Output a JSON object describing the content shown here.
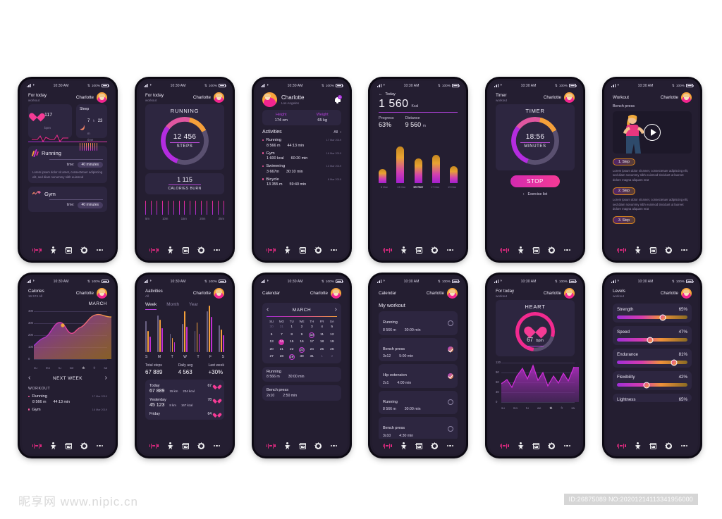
{
  "status_bar": {
    "time": "10:30 AM",
    "battery": "100%"
  },
  "nav": {
    "items": [
      "workout-icon",
      "profile-icon",
      "calendar-icon",
      "settings-icon",
      "more-icon"
    ]
  },
  "user": {
    "name": "Charlotte",
    "location": "Los Angeles"
  },
  "screens": {
    "today": {
      "header_title": "For today",
      "header_sub": "workout",
      "heart": {
        "value": "117",
        "unit": "bpm"
      },
      "sleep": {
        "title": "Sleep",
        "hours": "7",
        "h_unit": "h",
        "minutes": "23",
        "m_unit": "m",
        "label": "time"
      },
      "running": {
        "title": "Running",
        "time_label": "time:",
        "time_value": "40 minutes",
        "description": "Lorem ipsum dolor sit amet, consectetuer adipiscing elit, sed diam nonummy nibh euismod"
      },
      "gym": {
        "title": "Gym",
        "time_label": "time:",
        "time_value": "40 minutes"
      }
    },
    "running": {
      "header_title": "For today",
      "header_sub": "workout",
      "card_title": "RUNNING",
      "steps_value": "12 456",
      "steps_label": "STEPS",
      "calories_value": "1 115",
      "calories_label": "CALORIES BURN",
      "axis": [
        "5m",
        "10m",
        "15m",
        "20m",
        "25m"
      ]
    },
    "profile": {
      "height_label": "Height",
      "height_value": "174 cm",
      "weight_label": "Weight",
      "weight_value": "65 kg",
      "activities_title": "Activities",
      "all_label": "All",
      "notification_count": "1",
      "activities": [
        {
          "name": "Running",
          "date": "17 Mar 2019",
          "v1": "8 566 m",
          "v2": "44:13 min"
        },
        {
          "name": "Gym",
          "date": "16 Mar 2019",
          "v1": "1 600 kcal",
          "v2": "60:20 min"
        },
        {
          "name": "Swimming",
          "date": "13 Mar 2019",
          "v1": "3 667m",
          "v2": "30:10 min"
        },
        {
          "name": "Bicycle",
          "date": "8 Mar 2019",
          "v1": "13 355 m",
          "v2": "59:40 min"
        }
      ]
    },
    "kcal": {
      "back_label": "Today",
      "value": "1 560",
      "unit": "Kcal",
      "progress_label": "Progress",
      "progress_value": "63%",
      "distance_label": "Distance",
      "distance_value": "9 560",
      "distance_unit": "m"
    },
    "timer": {
      "header_title": "Timer",
      "header_sub": "workout",
      "card_title": "TIMER",
      "value": "18:56",
      "label": "MINUTES",
      "stop_label": "STOP",
      "exercise_list_label": "Exercise list"
    },
    "workout_video": {
      "header_title": "Workout",
      "exercise_name": "Bench press",
      "steps": [
        {
          "label": "1. Step",
          "text": "Lorem ipsum dolor sit amet, consectetuer adipiscing elit, sed diam nonummy nibh euismod tincidunt ut laoreet dolore magna aliquam erat"
        },
        {
          "label": "2. Step",
          "text": "Lorem ipsum dolor sit amet, consectetuer adipiscing elit, sed diam nonummy nibh euismod tincidunt ut laoreet dolore magna aliquam erat"
        },
        {
          "label": "3. Step",
          "text": ""
        }
      ]
    },
    "calories": {
      "header_title": "Calories",
      "header_sub": "16 574 All",
      "month": "MARCH",
      "next_week_label": "NEXT WEEK",
      "workout_label": "WORKOUT",
      "workouts": [
        {
          "name": "Running",
          "date": "17 Mar 2019",
          "v1": "8 566 m",
          "v2": "44:13 min"
        },
        {
          "name": "Gym",
          "date": "16 Mar 2019",
          "v1": "",
          "v2": ""
        }
      ]
    },
    "activities_stats": {
      "header_title": "Aativities",
      "header_sub": "All",
      "tabs": [
        "Week",
        "Month",
        "Year"
      ],
      "active_tab": "Week",
      "total_steps_label": "Total steps",
      "total_steps_value": "67 889",
      "daily_avg_label": "Daily avg",
      "daily_avg_value": "4 563",
      "last_week_label": "Last week",
      "last_week_value": "+30%",
      "rows": [
        {
          "day": "Today",
          "hr": "67",
          "steps": "67 889",
          "km": "15 km",
          "kcal": "234 kcal"
        },
        {
          "day": "Yesterday",
          "hr": "78",
          "steps": "45 123",
          "km": "8 km",
          "kcal": "167 kcal"
        },
        {
          "day": "Friday",
          "hr": "64",
          "steps": "",
          "km": "",
          "kcal": ""
        }
      ]
    },
    "calendar": {
      "header_title": "Calendar",
      "month": "MARCH",
      "day_headers": [
        "SU",
        "MO",
        "TU",
        "WE",
        "TH",
        "FR",
        "SA"
      ],
      "cells": [
        {
          "d": "30",
          "s": "mut"
        },
        {
          "d": "31",
          "s": "mut"
        },
        {
          "d": "1"
        },
        {
          "d": "2"
        },
        {
          "d": "3"
        },
        {
          "d": "4"
        },
        {
          "d": "5"
        },
        {
          "d": "6"
        },
        {
          "d": "7"
        },
        {
          "d": "8"
        },
        {
          "d": "9"
        },
        {
          "d": "10",
          "s": "circ"
        },
        {
          "d": "11"
        },
        {
          "d": "12"
        },
        {
          "d": "13"
        },
        {
          "d": "14",
          "s": "fill"
        },
        {
          "d": "15"
        },
        {
          "d": "16"
        },
        {
          "d": "17"
        },
        {
          "d": "18"
        },
        {
          "d": "19"
        },
        {
          "d": "20"
        },
        {
          "d": "21"
        },
        {
          "d": "22"
        },
        {
          "d": "23",
          "s": "circ"
        },
        {
          "d": "24"
        },
        {
          "d": "25"
        },
        {
          "d": "26"
        },
        {
          "d": "27"
        },
        {
          "d": "28"
        },
        {
          "d": "29",
          "s": "circ"
        },
        {
          "d": "30"
        },
        {
          "d": "31"
        },
        {
          "d": "1",
          "s": "mut"
        },
        {
          "d": "2",
          "s": "mut"
        }
      ],
      "events": [
        {
          "name": "Running",
          "v1": "8 566 m",
          "v2": "30:00 min"
        },
        {
          "name": "Bench press",
          "v1": "2x10",
          "v2": "2:50 min"
        }
      ]
    },
    "my_workout": {
      "header_title": "Calendar",
      "title": "My workout",
      "items": [
        {
          "name": "Running",
          "v1": "8 566 m",
          "v2": "30:00 min",
          "checked": false
        },
        {
          "name": "Bench press",
          "v1": "3x12",
          "v2": "5:00 min",
          "checked": true
        },
        {
          "name": "Hip extension",
          "v1": "2x1",
          "v2": "4:00 min",
          "checked": true
        },
        {
          "name": "Running",
          "v1": "8 566 m",
          "v2": "30:00 min",
          "checked": false
        },
        {
          "name": "Bench press",
          "v1": "3x10",
          "v2": "4:30 min",
          "checked": false
        }
      ]
    },
    "heart": {
      "header_title": "For today",
      "header_sub": "workout",
      "card_title": "HEART",
      "value": "67",
      "unit": "bpm"
    },
    "levels": {
      "header_title": "Levels",
      "header_sub": "workout",
      "items": [
        {
          "name": "Strength",
          "value": "65%",
          "pct": 65
        },
        {
          "name": "Speed",
          "value": "47%",
          "pct": 47
        },
        {
          "name": "Endurance",
          "value": "81%",
          "pct": 81
        },
        {
          "name": "Flexibility",
          "value": "42%",
          "pct": 42
        },
        {
          "name": "Lightness",
          "value": "65%",
          "pct": 65
        }
      ]
    }
  },
  "chart_data": [
    {
      "type": "bar",
      "title": "Daily Kcal",
      "categories": [
        "8 Mar",
        "13 Mar",
        "16 Mar",
        "17 Mar",
        "19 Mar"
      ],
      "values": [
        28,
        72,
        48,
        55,
        33
      ],
      "highlight": "16 Mar",
      "ylim": [
        0,
        80
      ]
    },
    {
      "type": "area",
      "title": "Calories MARCH",
      "x": [
        "su",
        "mo",
        "tu",
        "we",
        "th",
        "fr",
        "sa"
      ],
      "values": [
        110,
        175,
        245,
        215,
        160,
        230,
        290
      ],
      "yticks": [
        0,
        100,
        200,
        300,
        400
      ],
      "ylim": [
        0,
        400
      ],
      "highlight_x": "th"
    },
    {
      "type": "bar",
      "title": "Weekly steps",
      "categories": [
        "S",
        "M",
        "T",
        "W",
        "T",
        "F",
        "S"
      ],
      "series": [
        {
          "name": "grey",
          "values": [
            44,
            52,
            26,
            40,
            30,
            58,
            38
          ]
        },
        {
          "name": "orange",
          "values": [
            30,
            46,
            20,
            58,
            42,
            66,
            32
          ]
        },
        {
          "name": "purple",
          "values": [
            22,
            34,
            14,
            36,
            26,
            50,
            24
          ]
        }
      ],
      "ylim": [
        0,
        70
      ]
    },
    {
      "type": "line",
      "title": "Heart rate",
      "x": [
        "su",
        "mo",
        "tu",
        "we",
        "th",
        "fr",
        "sa"
      ],
      "values": [
        52,
        68,
        48,
        40,
        92,
        75,
        105,
        70,
        86,
        44,
        72,
        50,
        78,
        62,
        95
      ],
      "yticks": [
        0,
        30,
        60,
        90,
        120
      ],
      "ylim": [
        0,
        120
      ],
      "highlight_x": "th"
    },
    {
      "type": "bar",
      "title": "Running interval",
      "categories": [
        "5m",
        "10m",
        "15m",
        "20m",
        "25m"
      ],
      "values": [
        20,
        20,
        20,
        20,
        20
      ]
    }
  ],
  "watermark": {
    "site": "昵享网 www.nipic.cn",
    "id": "ID:26875089 NO:20201214113341956000"
  }
}
